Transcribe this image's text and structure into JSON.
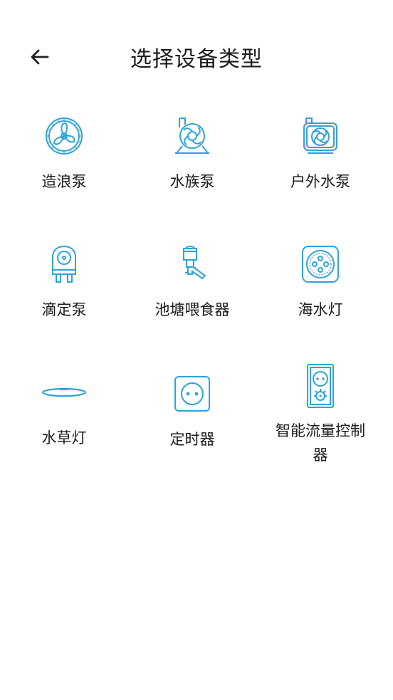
{
  "header": {
    "title": "选择设备类型",
    "back_icon": "arrow-left-icon"
  },
  "accent_color": "#2fa3d8",
  "devices": [
    {
      "label": "造浪泵",
      "icon": "wave-pump-icon"
    },
    {
      "label": "水族泵",
      "icon": "aquarium-pump-icon"
    },
    {
      "label": "户外水泵",
      "icon": "outdoor-pump-icon"
    },
    {
      "label": "滴定泵",
      "icon": "dosing-pump-icon"
    },
    {
      "label": "池塘喂食器",
      "icon": "pond-feeder-icon"
    },
    {
      "label": "海水灯",
      "icon": "marine-light-icon"
    },
    {
      "label": "水草灯",
      "icon": "plant-light-icon"
    },
    {
      "label": "定时器",
      "icon": "timer-socket-icon"
    },
    {
      "label": "智能流量控制器",
      "icon": "flow-controller-icon"
    }
  ]
}
